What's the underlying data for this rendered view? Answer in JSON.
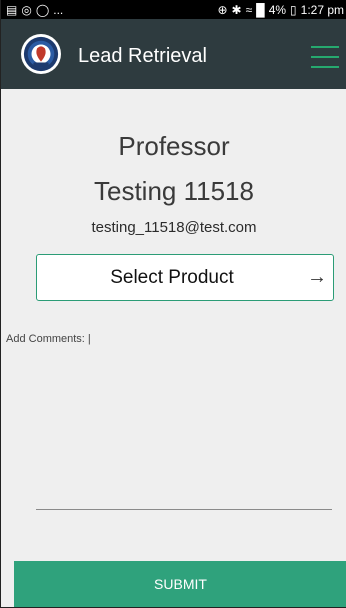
{
  "status_bar": {
    "left_icons": [
      "image-icon",
      "at-icon",
      "whatsapp-icon"
    ],
    "ellipsis": "...",
    "right_icons": [
      "data-saver-icon",
      "bluetooth-icon",
      "wifi-icon",
      "signal-icon"
    ],
    "battery_text": "4%",
    "time": "1:27 pm"
  },
  "app_bar": {
    "title": "Lead Retrieval",
    "logo_icon": "eacts-logo-icon",
    "menu_icon": "hamburger-menu-icon",
    "background": "#2e3b3f",
    "accent": "#26a96f"
  },
  "profile": {
    "first_line": "Professor",
    "second_line": "Testing 11518",
    "email": "testing_11518@test.com"
  },
  "product": {
    "label": "Select Product",
    "arrow": "→"
  },
  "comments": {
    "label": "Add Comments: |",
    "value": ""
  },
  "submit": {
    "label": "SUBMIT",
    "color": "#2fa27c"
  }
}
